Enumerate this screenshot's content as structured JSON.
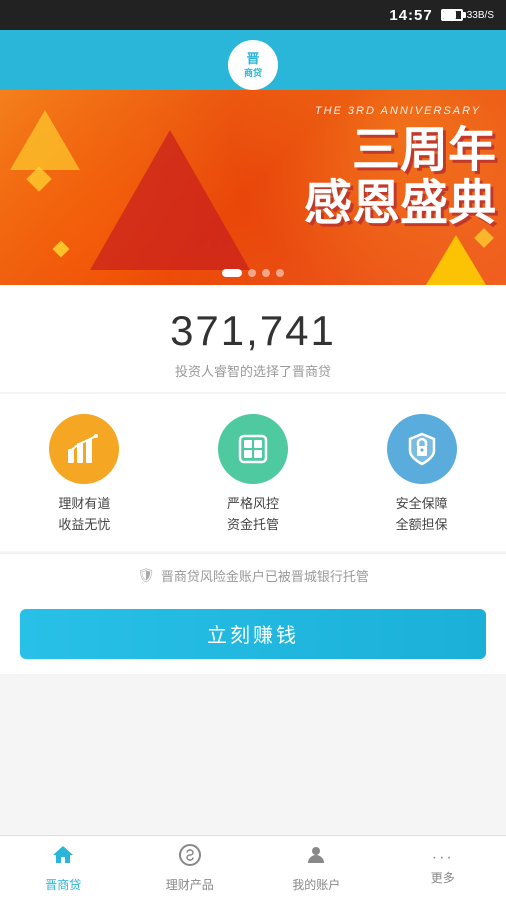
{
  "statusBar": {
    "time": "14:57",
    "speed": "33B/S"
  },
  "header": {
    "logo": "晋",
    "logoSubtext": "商贷"
  },
  "banner": {
    "anniversary_line": "THE 3RD ANNIVERSARY",
    "text_line1": "三周年",
    "text_line2": "感恩盛典",
    "dots": [
      true,
      false,
      false,
      false
    ]
  },
  "stats": {
    "number": "371,741",
    "description": "投资人睿智的选择了晋商贷"
  },
  "features": [
    {
      "label_line1": "理财有道",
      "label_line2": "收益无忧",
      "icon_symbol": "📈",
      "color_class": "orange"
    },
    {
      "label_line1": "严格风控",
      "label_line2": "资金托管",
      "icon_symbol": "⊞",
      "color_class": "teal"
    },
    {
      "label_line1": "安全保障",
      "label_line2": "全额担保",
      "icon_symbol": "🔒",
      "color_class": "blue"
    }
  ],
  "trustNotice": {
    "text": "晋商贷风险金账户已被晋城银行托管"
  },
  "cta": {
    "label": "立刻赚钱"
  },
  "bottomNav": {
    "items": [
      {
        "label": "晋商贷",
        "icon": "home",
        "active": true
      },
      {
        "label": "理财产品",
        "icon": "dollar",
        "active": false
      },
      {
        "label": "我的账户",
        "icon": "user",
        "active": false
      },
      {
        "label": "更多",
        "icon": "dots",
        "active": false
      }
    ]
  }
}
